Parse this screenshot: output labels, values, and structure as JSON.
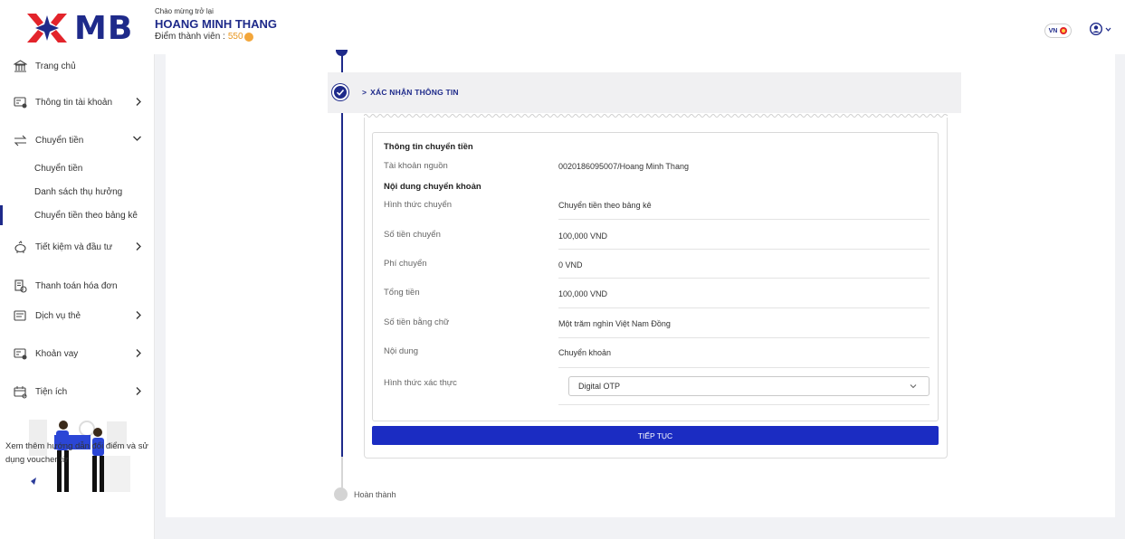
{
  "header": {
    "brand": "MB",
    "greeting": "Chào mừng trở lại",
    "user_name": "HOANG MINH THANG",
    "points_label": "Điểm thành viên :",
    "points_value": "550",
    "language": "VN"
  },
  "sidebar": {
    "items": [
      {
        "label": "Trang chủ",
        "icon": "bank-icon"
      },
      {
        "label": "Thông tin tài khoản",
        "icon": "account-card-icon"
      },
      {
        "label": "Chuyển tiền",
        "icon": "transfer-icon"
      },
      {
        "label": "Tiết kiệm và đầu tư",
        "icon": "piggy-bank-icon"
      },
      {
        "label": "Thanh toán hóa đơn",
        "icon": "bill-icon"
      },
      {
        "label": "Dịch vụ thẻ",
        "icon": "card-service-icon"
      },
      {
        "label": "Khoản vay",
        "icon": "loan-icon"
      },
      {
        "label": "Tiện ích",
        "icon": "utilities-icon"
      }
    ],
    "transfer_sub": [
      {
        "label": "Chuyển tiền"
      },
      {
        "label": "Danh sách thụ hưởng"
      },
      {
        "label": "Chuyển tiền theo bảng kê",
        "active": true
      }
    ],
    "promo_text": "Xem thêm hướng dẫn đổi điểm và sử dụng voucher từ"
  },
  "step": {
    "title": "XÁC NHẬN THÔNG TIN",
    "done_label": "Hoàn thành"
  },
  "form": {
    "section_transfer": "Thông tin chuyển tiền",
    "source_label": "Tài khoản nguồn",
    "source_value": "0020186095007/Hoang Minh Thang",
    "section_content": "Nội dung chuyển khoản",
    "rows": [
      {
        "label": "Hình thức chuyển",
        "value": "Chuyển tiền theo bảng kê"
      },
      {
        "label": "Số tiền chuyển",
        "value": "100,000 VND"
      },
      {
        "label": "Phí chuyển",
        "value": "0 VND"
      },
      {
        "label": "Tổng tiền",
        "value": "100,000 VND"
      },
      {
        "label": "Số tiền bằng chữ",
        "value": "Một trăm nghìn Việt Nam Đồng"
      },
      {
        "label": "Nội dung",
        "value": "Chuyển khoản"
      }
    ],
    "auth_label": "Hình thức xác thực",
    "auth_selected": "Digital OTP",
    "continue_label": "TIẾP TỤC"
  },
  "colors": {
    "brand": "#1e2a8a",
    "button": "#1b2cc2",
    "points": "#e8961f"
  }
}
